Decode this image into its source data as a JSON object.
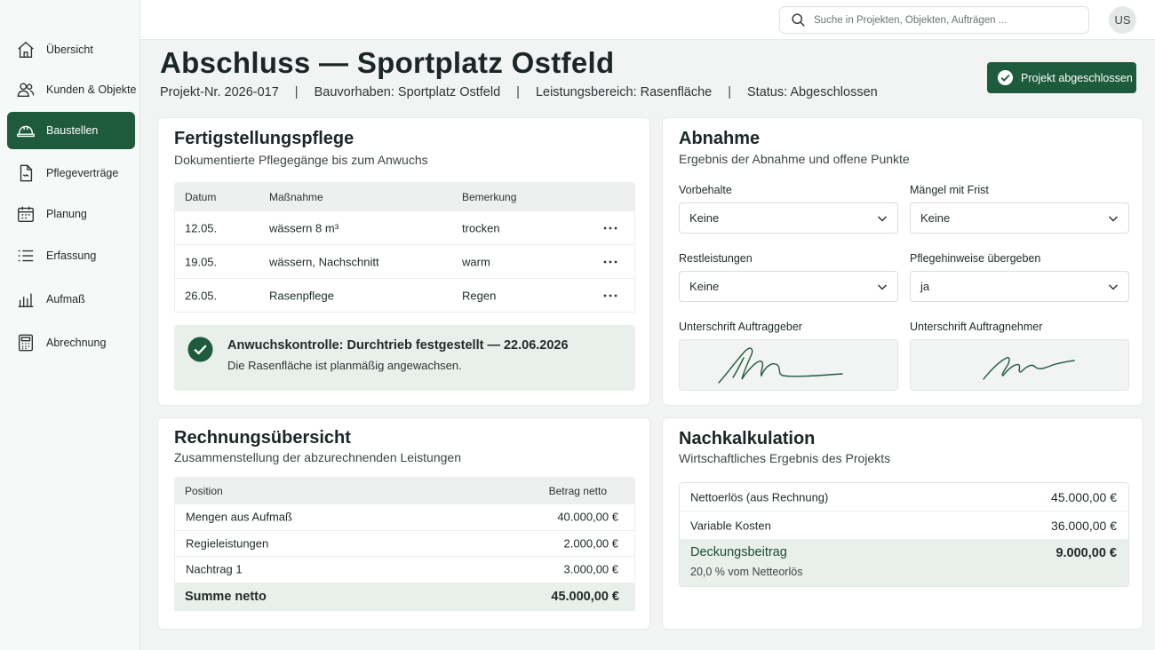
{
  "sidebar": {
    "items": [
      {
        "label": "Übersicht",
        "icon": "home-icon"
      },
      {
        "label": "Kunden & Objekte",
        "icon": "users-icon"
      },
      {
        "label": "Baustellen",
        "icon": "construction-helmet-icon",
        "active": true
      },
      {
        "label": "Pflegeverträge",
        "icon": "contract-icon"
      },
      {
        "label": "Planung",
        "icon": "calendar-icon"
      },
      {
        "label": "Erfassung",
        "icon": "list-icon"
      },
      {
        "label": "Aufmaß",
        "icon": "bar-chart-icon"
      },
      {
        "label": "Abrechnung",
        "icon": "calculator-icon"
      }
    ]
  },
  "header": {
    "search_placeholder": "Suche in Projekten, Objekten, Aufträgen ...",
    "avatar_initials": "US"
  },
  "page": {
    "title": "Abschluss — Sportplatz Ostfeld",
    "meta": [
      "Projekt-Nr. 2026-017",
      "Bauvorhaben: Sportplatz Ostfeld",
      "Leistungsbereich: Rasenfläche",
      "Status: Abgeschlossen"
    ],
    "meta_separator": "|",
    "action_label": "Projekt abgeschlossen"
  },
  "pflege": {
    "title": "Fertigstellungspflege",
    "subtitle": "Dokumentierte Pflegegänge bis zum Anwuchs",
    "columns": [
      "Datum",
      "Maßnahme",
      "Bemerkung"
    ],
    "rows": [
      {
        "datum": "12.05.",
        "massnahme": "wässern 8 m³",
        "bemerkung": "trocken"
      },
      {
        "datum": "19.05.",
        "massnahme": "wässern, Nachschnitt",
        "bemerkung": "warm"
      },
      {
        "datum": "26.05.",
        "massnahme": "Rasenpflege",
        "bemerkung": "Regen"
      }
    ],
    "banner_title": "Anwuchskontrolle: Durchtrieb festgestellt — 22.06.2026",
    "banner_text": "Die Rasenfläche ist planmäßig angewachsen."
  },
  "abnahme": {
    "title": "Abnahme",
    "subtitle": "Ergebnis der Abnahme und offene Punkte",
    "vorbehalte_label": "Vorbehalte",
    "vorbehalte_value": "Keine",
    "maengel_label": "Mängel mit Frist",
    "maengel_value": "Keine",
    "rest_label": "Restleistungen",
    "rest_value": "Keine",
    "pflegehinweise_label": "Pflegehinweise übergeben",
    "pflegehinweise_value": "ja",
    "sig_client_label": "Unterschrift Auftraggeber",
    "sig_contractor_label": "Unterschrift Auftragnehmer"
  },
  "rechnung": {
    "title": "Rechnungsübersicht",
    "subtitle": "Zusammenstellung der abzurechnenden Leistungen",
    "columns": [
      "Position",
      "Betrag netto"
    ],
    "rows": [
      {
        "position": "Mengen aus Aufmaß",
        "betrag": "40.000,00 €"
      },
      {
        "position": "Regieleistungen",
        "betrag": "2.000,00 €"
      },
      {
        "position": "Nachtrag 1",
        "betrag": "3.000,00 €"
      }
    ],
    "sum_label": "Summe netto",
    "sum_value": "45.000,00 €"
  },
  "nachkalkulation": {
    "title": "Nachkalkulation",
    "subtitle": "Wirtschaftliches Ergebnis des Projekts",
    "rows": [
      {
        "label": "Nettoerlös (aus Rechnung)",
        "value": "45.000,00 €"
      },
      {
        "label": "Variable Kosten",
        "value": "36.000,00 €"
      }
    ],
    "db_label": "Deckungsbeitrag",
    "db_note": "20,0 % vom Netteorlös",
    "db_value": "9.000,00 €"
  },
  "colors": {
    "accent": "#1e5b3c",
    "success_bg": "#e9f0eb",
    "background": "#f2f3f3"
  }
}
